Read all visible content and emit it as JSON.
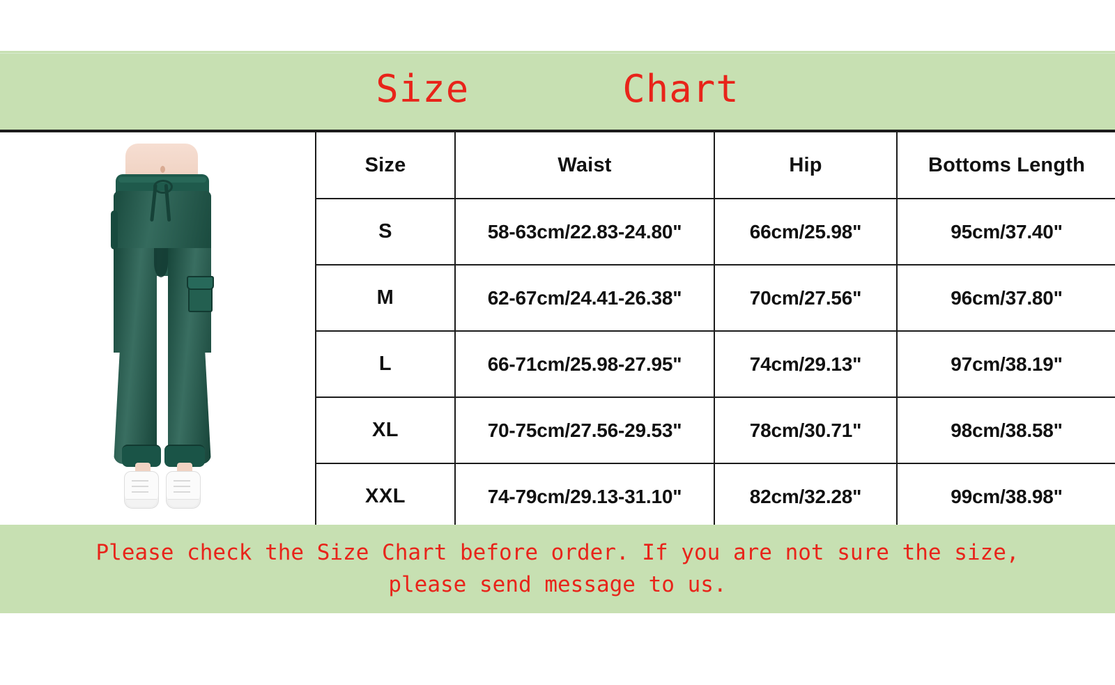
{
  "header": {
    "title_left": "Size",
    "title_right": "Chart",
    "band_color": "#c7e0b2",
    "title_color": "#e8241a"
  },
  "product_image": {
    "alt": "woman wearing dark green cargo jogger pants with white high-top sneakers",
    "pants_color": "#1e5a4b",
    "shoe_color": "#fbfbfb"
  },
  "chart_data": {
    "type": "table",
    "title": "Size Chart",
    "columns": [
      "Size",
      "Waist",
      "Hip",
      "Bottoms Length"
    ],
    "rows": [
      {
        "size": "S",
        "waist": "58-63cm/22.83-24.80\"",
        "hip": "66cm/25.98\"",
        "length": "95cm/37.40\""
      },
      {
        "size": "M",
        "waist": "62-67cm/24.41-26.38\"",
        "hip": "70cm/27.56\"",
        "length": "96cm/37.80\""
      },
      {
        "size": "L",
        "waist": "66-71cm/25.98-27.95\"",
        "hip": "74cm/29.13\"",
        "length": "97cm/38.19\""
      },
      {
        "size": "XL",
        "waist": "70-75cm/27.56-29.53\"",
        "hip": "78cm/30.71\"",
        "length": "98cm/38.58\""
      },
      {
        "size": "XXL",
        "waist": "74-79cm/29.13-31.10\"",
        "hip": "82cm/32.28\"",
        "length": "99cm/38.98\""
      }
    ]
  },
  "footer": {
    "line1": "Please check the Size Chart before order. If you are not sure the size,",
    "line2": "please send message to us.",
    "band_color": "#c7e0b2",
    "text_color": "#e8241a"
  }
}
